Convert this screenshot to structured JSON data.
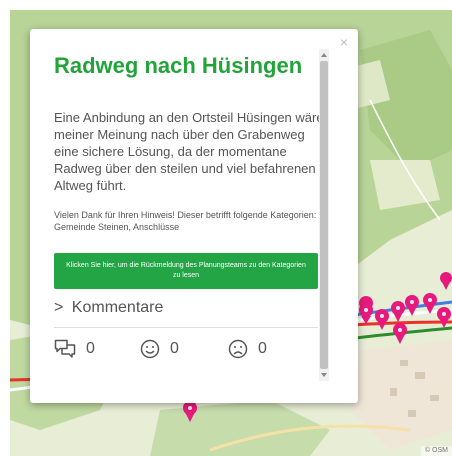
{
  "popup": {
    "close_label": "×",
    "title": "Radweg nach Hüsingen",
    "body": "Eine Anbindung an den Ortsteil Hüsingen wäre meiner Meinung nach über den Grabenweg eine sichere Lösung, da der momentane Radweg über den steilen und viel befahrenen Altweg führt.",
    "thanks": "Vielen Dank für Ihren Hinweis! Dieser betrifft folgende Kategorien: Gemeinde Steinen, Anschlüsse",
    "cta_label": "Klicken Sie hier, um die Rückmeldung des Planungsteams zu den Kategorien zu lesen",
    "comments_chevron": ">",
    "comments_label": "Kommentare",
    "reactions": [
      {
        "icon": "comments-icon",
        "count": "0"
      },
      {
        "icon": "smile-icon",
        "count": "0"
      },
      {
        "icon": "frown-icon",
        "count": "0"
      }
    ]
  },
  "colors": {
    "title_green": "#22a43a",
    "button_green": "#23a546",
    "map_bg": "#e6edd4",
    "forest": "#b9d59a",
    "route_red": "#e8322a",
    "route_green": "#2e8b2e",
    "route_blue": "#3e7fe0",
    "marker_pink": "#e8197c"
  },
  "map": {
    "attribution": "© OSM"
  }
}
